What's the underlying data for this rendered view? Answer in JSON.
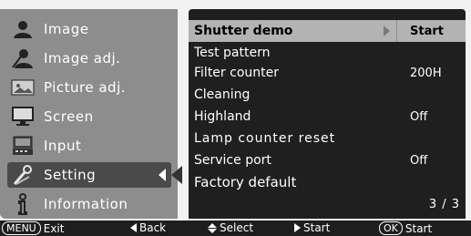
{
  "sidebar": {
    "items": [
      {
        "label": "Image",
        "icon": "person-silhouette-icon"
      },
      {
        "label": "Image adj.",
        "icon": "image-adjust-icon"
      },
      {
        "label": "Picture adj.",
        "icon": "picture-adjust-icon"
      },
      {
        "label": "Screen",
        "icon": "screen-icon"
      },
      {
        "label": "Input",
        "icon": "input-icon"
      },
      {
        "label": "Setting",
        "icon": "wrench-icon"
      },
      {
        "label": "Information",
        "icon": "info-icon"
      }
    ],
    "active_index": 5
  },
  "panel": {
    "rows": [
      {
        "name": "Shutter demo",
        "value": "Start"
      },
      {
        "name": "Test pattern",
        "value": ""
      },
      {
        "name": "Filter counter",
        "value": "200H"
      },
      {
        "name": "Cleaning",
        "value": ""
      },
      {
        "name": "Highland",
        "value": "Off"
      },
      {
        "name": "Lamp counter reset",
        "value": ""
      },
      {
        "name": "Service port",
        "value": "Off"
      },
      {
        "name": "Factory default",
        "value": ""
      }
    ],
    "page": "3 / 3"
  },
  "footer": {
    "menu_badge": "MENU",
    "exit": "Exit",
    "back": "Back",
    "select": "Select",
    "start": "Start",
    "ok_badge": "OK",
    "ok_start": "Start"
  },
  "colors": {
    "sidebar": "#8d8d8d",
    "panel": "#1f1f1f",
    "highlight": "#b3b3b3",
    "active": "#4a4a4a"
  }
}
